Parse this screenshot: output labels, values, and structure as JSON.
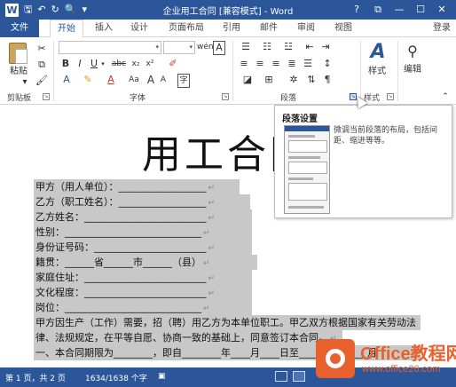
{
  "window": {
    "title": "企业用工合同 [兼容模式] - Word",
    "app_icon": "W",
    "buttons": {
      "help": "?",
      "restore": "⧉",
      "minimize": "—",
      "maximize": "☐",
      "close": "✕"
    }
  },
  "tabs": {
    "file": "文件",
    "items": [
      "开始",
      "插入",
      "设计",
      "页面布局",
      "引用",
      "邮件",
      "审阅",
      "视图"
    ],
    "active": "开始",
    "login": "登录"
  },
  "ribbon": {
    "clipboard": {
      "paste": "粘贴",
      "label": "剪贴板"
    },
    "font": {
      "label": "字体",
      "bold": "B",
      "italic": "I",
      "underline": "U",
      "strike": "abc",
      "sub": "x₂",
      "sup": "x²",
      "grow": "A",
      "aa": "Aa"
    },
    "paragraph": {
      "label": "段落"
    },
    "styles": {
      "button": "样式",
      "label": "样式"
    },
    "editing": {
      "button": "编辑"
    }
  },
  "tooltip": {
    "title": "段落设置",
    "description": "微调当前段落的布局，包括间距、缩进等等。"
  },
  "document": {
    "title": "用工合同",
    "lines": [
      "甲方（用人单位）：__________________",
      "乙方（职工姓名）：__________________",
      "乙方姓名：_________________________",
      "性别：____________________________",
      "身份证号码：_______________________",
      "籍贯：______省______市______（县）",
      "家庭住址：_________________________",
      "文化程度：_________________________",
      "岗位：____________________________",
      "甲方因生产（工作）需要，招（聘）用乙方为本单位职工。甲乙双方根据国家有关劳动法",
      "律、法规规定，在平等自愿、协商一致的基础上，同意签订本合同。",
      "一、本合同期限为________，即自________年____月____日至________年____月"
    ],
    "paragraph_mark": "↵"
  },
  "statusbar": {
    "page": "第 1 页，共 2 页",
    "words": "1634/1638 个字",
    "lang_icon": "proofing-icon"
  },
  "watermark": {
    "brand": "Office教程网",
    "url": "www.office26.com"
  },
  "colors": {
    "accent": "#2b579a",
    "selection": "#c8c8c8",
    "watermark": "#e8612c"
  }
}
